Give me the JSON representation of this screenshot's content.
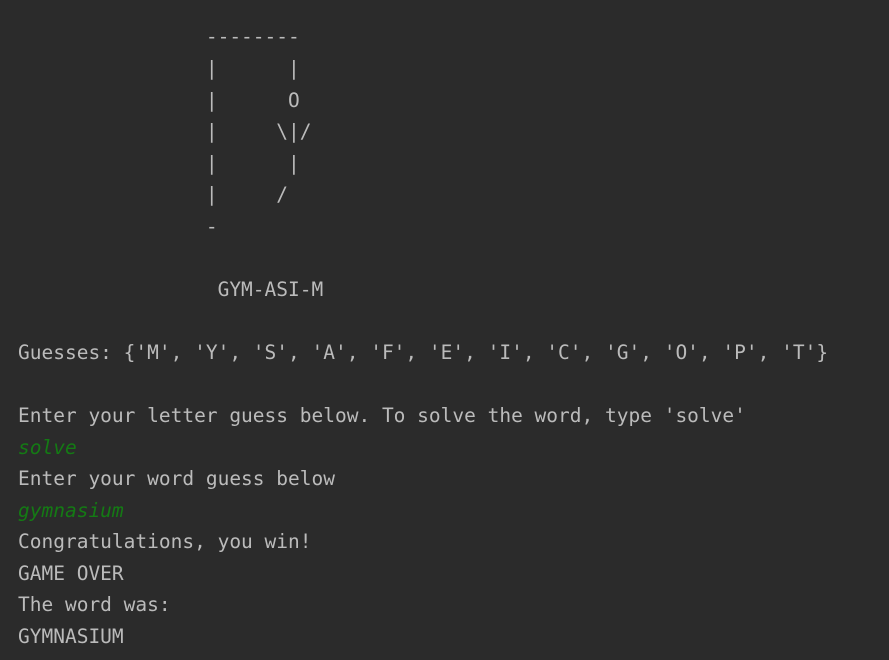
{
  "console": {
    "gallows": [
      "                --------",
      "                |      |",
      "                |      O",
      "                |     \\|/",
      "                |      |",
      "                |     /",
      "                -"
    ],
    "masked_word": "                 GYM-ASI-M",
    "guesses_line": "Guesses: {'M', 'Y', 'S', 'A', 'F', 'E', 'I', 'C', 'G', 'O', 'P', 'T'}",
    "prompt_letter": "Enter your letter guess below. To solve the word, type 'solve'",
    "input_solve": "solve",
    "prompt_word": "Enter your word guess below",
    "input_word": "gymnasium",
    "congrats": "Congratulations, you win!",
    "game_over": "GAME OVER",
    "word_was_label": "The word was:",
    "final_word": "GYMNASIUM"
  },
  "colors": {
    "background": "#2b2b2b",
    "output_text": "#bbbbbb",
    "user_input_text": "#147a14"
  }
}
